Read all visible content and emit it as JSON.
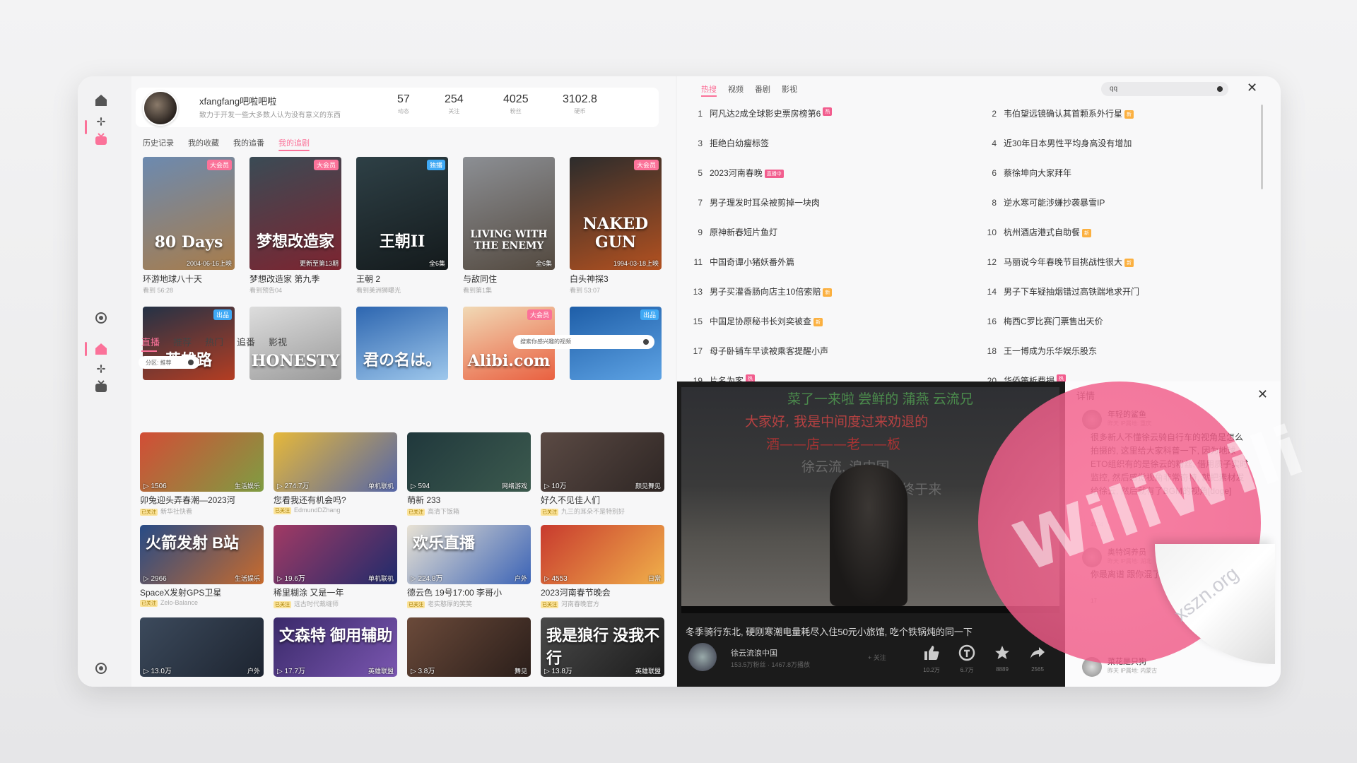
{
  "profile": {
    "name": "xfangfang吧啦吧啦",
    "signature": "致力于开发一些大多数人认为没有意义的东西",
    "stats": [
      {
        "value": "57",
        "label": "动态"
      },
      {
        "value": "254",
        "label": "关注"
      },
      {
        "value": "4025",
        "label": "粉丝"
      },
      {
        "value": "3102.8",
        "label": "硬币"
      }
    ],
    "tabs": [
      "历史记录",
      "我的收藏",
      "我的追番",
      "我的追剧"
    ]
  },
  "shows_row1": [
    {
      "title": "环游地球八十天",
      "sub": "看到 56:28",
      "badge": "大会员",
      "date": "2004-06-16上映",
      "art": "80 Days",
      "color1": "#6c8ab0",
      "color2": "#a87c4a"
    },
    {
      "title": "梦想改造家 第九季",
      "sub": "看到预告04",
      "badge": "大会员",
      "date": "更新至第13期",
      "art": "梦想改造家",
      "color1": "#3a4b55",
      "color2": "#7d2430"
    },
    {
      "title": "王朝 2",
      "sub": "看到美洲狮曝光",
      "badge": "独播",
      "date": "全6集",
      "art": "王朝II",
      "color1": "#2e4046",
      "color2": "#141a1c"
    },
    {
      "title": "与敌同住",
      "sub": "看到第1集",
      "badge": "",
      "date": "全6集",
      "art": "LIVING WITH THE ENEMY",
      "color1": "#8c8f94",
      "color2": "#53493f"
    },
    {
      "title": "白头神探3",
      "sub": "看到 53:07",
      "badge": "大会员",
      "date": "1994-03-18上映",
      "art": "NAKED GUN",
      "color1": "#2c2c2c",
      "color2": "#b35120"
    }
  ],
  "shows_row2": [
    {
      "badge": "出品",
      "art": "英雄路",
      "color1": "#243246",
      "color2": "#b43d22"
    },
    {
      "badge": "",
      "art": "HONESTY",
      "color1": "#dddddd",
      "color2": "#9a9a9a"
    },
    {
      "badge": "",
      "art": "君の名は。",
      "color1": "#2d66b0",
      "color2": "#9fc8ec"
    },
    {
      "badge": "大会员",
      "art": "Alibi.com",
      "color1": "#f1d9b5",
      "color2": "#e96040"
    },
    {
      "badge": "出品",
      "art": "",
      "color1": "#1e5ea8",
      "color2": "#5ea3e4"
    }
  ],
  "feed_tabs": [
    "直播",
    "推荐",
    "热门",
    "追番",
    "影视"
  ],
  "feed_search_placeholder": "搜索你感兴趣的视频",
  "feed_chip": "分区: 推荐",
  "videos": [
    {
      "title": "卯兔迎头弄春潮—2023河",
      "up": "新华社快看",
      "views": "1506",
      "cat": "生活娱乐",
      "big": "",
      "color1": "#d24d36",
      "color2": "#7f9d42"
    },
    {
      "title": "您看我还有机会吗?",
      "up": "EdmundDZhang",
      "views": "274.7万",
      "cat": "单机联机",
      "big": "",
      "color1": "#e6b83a",
      "color2": "#5566a8"
    },
    {
      "title": "萌新 233",
      "up": "高清下饭箱",
      "views": "594",
      "cat": "网络游戏",
      "big": "",
      "color1": "#20383c",
      "color2": "#3c5a4e"
    },
    {
      "title": "好久不见佳人们",
      "up": "九三的耳朵不是特别好",
      "views": "10万",
      "cat": "颜见舞见",
      "big": "",
      "color1": "#5b4a44",
      "color2": "#2e2624"
    },
    {
      "title": "SpaceX发射GPS卫星",
      "up": "Zelo-Balance",
      "views": "2966",
      "cat": "生活娱乐",
      "big": "火箭发射 B站",
      "color1": "#274b86",
      "color2": "#c86b2d"
    },
    {
      "title": "稀里糊涂 又是一年",
      "up": "远古时代裁缝师",
      "views": "19.6万",
      "cat": "单机联机",
      "big": "",
      "color1": "#a23a64",
      "color2": "#1f2b6c"
    },
    {
      "title": "德云色 19号17:00 李哥小",
      "up": "老实憨厚的笑笑",
      "views": "224.8万",
      "cat": "户外",
      "big": "欢乐直播",
      "color1": "#e8e2d4",
      "color2": "#3b63b6"
    },
    {
      "title": "2023河南春节晚会",
      "up": "河南春晚官方",
      "views": "4553",
      "cat": "日常",
      "big": "",
      "color1": "#c83a2e",
      "color2": "#f0b04a"
    },
    {
      "title": "",
      "up": "",
      "views": "13.0万",
      "cat": "户外",
      "big": "",
      "color1": "#3c4a5c",
      "color2": "#1d2430"
    },
    {
      "title": "",
      "up": "",
      "views": "17.7万",
      "cat": "英雄联盟",
      "big": "文森特 御用辅助",
      "color1": "#3a2a6a",
      "color2": "#7a56b0"
    },
    {
      "title": "",
      "up": "",
      "views": "3.8万",
      "cat": "舞见",
      "big": "",
      "color1": "#6b4a3a",
      "color2": "#2a1e1a"
    },
    {
      "title": "",
      "up": "",
      "views": "13.8万",
      "cat": "英雄联盟",
      "big": "我是狼行 没我不行",
      "color1": "#4a4a4a",
      "color2": "#1c1c1c"
    }
  ],
  "trending": {
    "tabs": [
      "热搜",
      "视频",
      "番剧",
      "影视"
    ],
    "search_value": "qq",
    "items": [
      {
        "n": "1",
        "text": "阿凡达2成全球影史票房榜第6",
        "tag": "热",
        "tagclass": "hot"
      },
      {
        "n": "2",
        "text": "韦伯望远镜确认其首颗系外行星",
        "tag": "新",
        "tagclass": "new"
      },
      {
        "n": "3",
        "text": "拒绝白幼瘦标签",
        "tag": "",
        "tagclass": ""
      },
      {
        "n": "4",
        "text": "近30年日本男性平均身高没有增加",
        "tag": "",
        "tagclass": ""
      },
      {
        "n": "5",
        "text": "2023河南春晚",
        "tag": "直播中",
        "tagclass": "live"
      },
      {
        "n": "6",
        "text": "蔡徐坤向大家拜年",
        "tag": "",
        "tagclass": ""
      },
      {
        "n": "7",
        "text": "男子理发时耳朵被剪掉一块肉",
        "tag": "",
        "tagclass": ""
      },
      {
        "n": "8",
        "text": "逆水寒可能涉嫌抄袭暴雪IP",
        "tag": "",
        "tagclass": ""
      },
      {
        "n": "9",
        "text": "原神新春短片鱼灯",
        "tag": "",
        "tagclass": ""
      },
      {
        "n": "10",
        "text": "杭州酒店港式自助餐",
        "tag": "新",
        "tagclass": "new"
      },
      {
        "n": "11",
        "text": "中国奇谭小猪妖番外篇",
        "tag": "",
        "tagclass": ""
      },
      {
        "n": "12",
        "text": "马丽说今年春晚节目挑战性很大",
        "tag": "新",
        "tagclass": "new"
      },
      {
        "n": "13",
        "text": "男子买灌香肠向店主10倍索赔",
        "tag": "新",
        "tagclass": "new"
      },
      {
        "n": "14",
        "text": "男子下车疑抽烟错过高铁踹地求开门",
        "tag": "",
        "tagclass": ""
      },
      {
        "n": "15",
        "text": "中国足协原秘书长刘奕被查",
        "tag": "新",
        "tagclass": "new"
      },
      {
        "n": "16",
        "text": "梅西C罗比赛门票售出天价",
        "tag": "",
        "tagclass": ""
      },
      {
        "n": "17",
        "text": "母子卧铺车早读被乘客提醒小声",
        "tag": "",
        "tagclass": ""
      },
      {
        "n": "18",
        "text": "王一博成为乐华娱乐股东",
        "tag": "",
        "tagclass": ""
      },
      {
        "n": "19",
        "text": "片名为客",
        "tag": "热",
        "tagclass": "hot"
      },
      {
        "n": "20",
        "text": "华侨策析费揭",
        "tag": "热",
        "tagclass": "hot"
      }
    ]
  },
  "player": {
    "danmaku_top": "菜了一来啦 尝鲜的 蒲燕 云流兄",
    "subtitle1": "大家好, 我是中间度过来劝退的",
    "subtitle2": "酒——店——老——板",
    "subtitle3": "徐云流, 浪中国",
    "subtitle4": "老板血亏   终于来",
    "description": "冬季骑行东北, 硬刚寒潮电量耗尽入住50元小旅馆, 吃个铁锅炖的同一下",
    "author": "徐云流浪中国",
    "author_meta": "153.5万粉丝 · 1467.8万播放",
    "follow": "+ 关注",
    "actions": [
      {
        "icon": "like-icon",
        "count": "10.2万"
      },
      {
        "icon": "coin-icon",
        "count": "6.7万"
      },
      {
        "icon": "star-icon",
        "count": "8889"
      },
      {
        "icon": "share-icon",
        "count": "2565"
      }
    ]
  },
  "comments": {
    "title": "详情",
    "items": [
      {
        "name": "年轻的鲨鱼",
        "meta": "昨天  IP属地: 重庆",
        "text": "很多新人不懂徐云骑自行车的视角是怎么拍摄的, 这里给大家科普一下, 因为地球ETO组织有的是徐云的粉丝, 借用质子实时监控, 然后感觉视角非常奇特, 就把素材发给徐云, 然后就有了BGM的视角[doge]",
        "likes": "4154"
      },
      {
        "name": "奥特饲养员",
        "meta": "昨天  IP属地: 湖北",
        "text": "你最离谱 跟你混了[脱单doge][脱单doge]",
        "likes": "17"
      },
      {
        "name": "菜花是只狗",
        "meta": "昨天  IP属地: 内蒙古",
        "text": "",
        "likes": ""
      }
    ]
  },
  "watermark": {
    "logo": "WiliWili",
    "site": "xszn.org"
  }
}
